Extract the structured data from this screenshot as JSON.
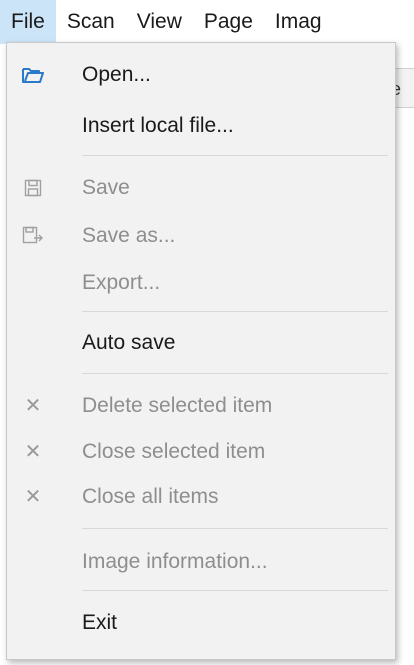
{
  "menubar": {
    "items": [
      {
        "label": "File"
      },
      {
        "label": "Scan"
      },
      {
        "label": "View"
      },
      {
        "label": "Page"
      },
      {
        "label": "Imag"
      }
    ]
  },
  "background_hint": "e",
  "menu": {
    "open": "Open...",
    "insert_local_file": "Insert local file...",
    "save": "Save",
    "save_as": "Save as...",
    "export": "Export...",
    "auto_save": "Auto save",
    "delete_selected_item": "Delete selected item",
    "close_selected_item": "Close selected item",
    "close_all_items": "Close all items",
    "image_information": "Image information...",
    "exit": "Exit"
  },
  "colors": {
    "menubar_active": "#cce4f7",
    "menu_bg": "#f2f2f2",
    "open_icon": "#2b79c9",
    "disabled_text": "#8e8e8e"
  }
}
